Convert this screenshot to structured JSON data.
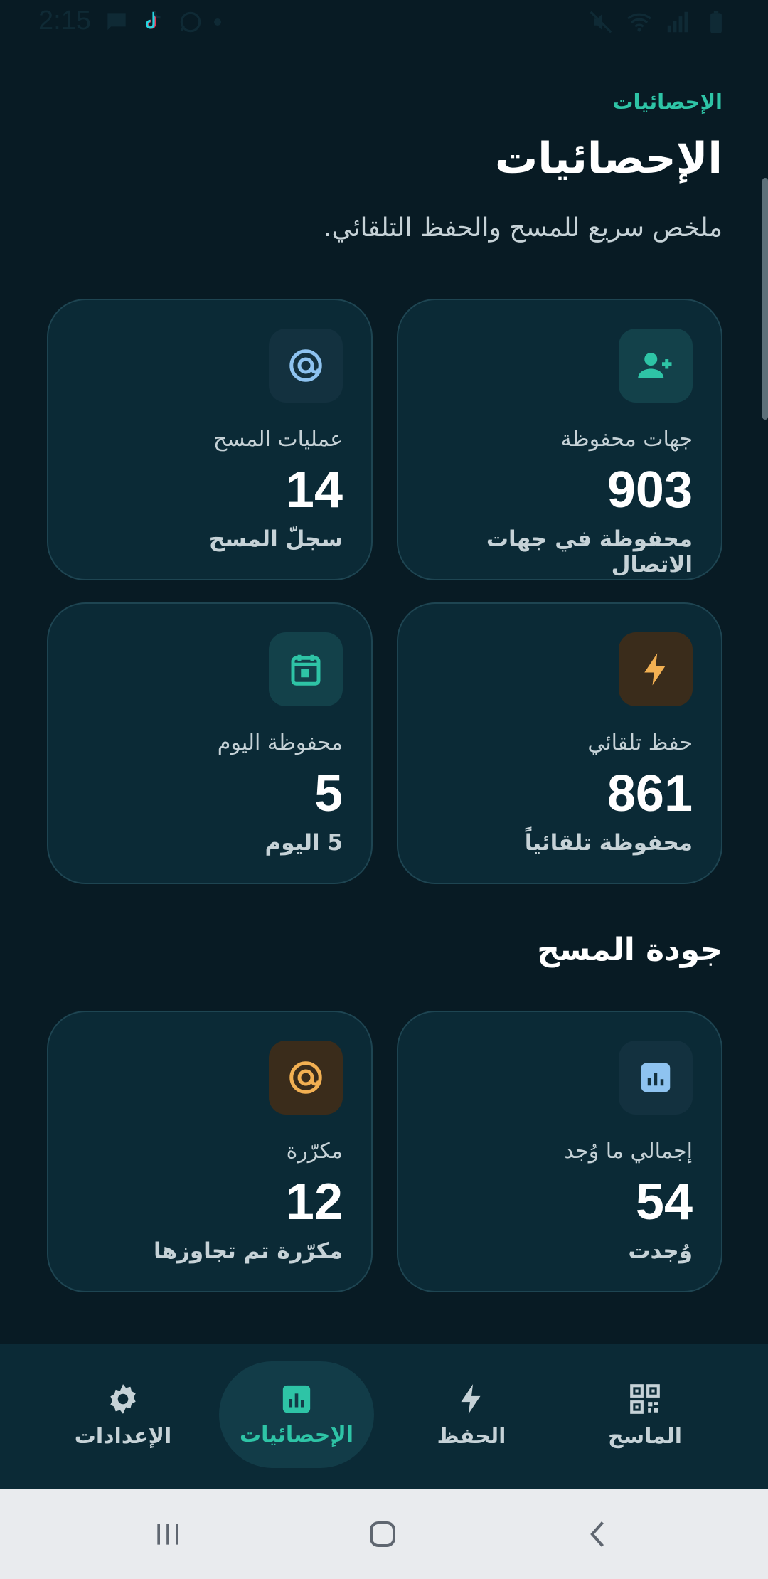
{
  "status_bar": {
    "time": "2:15",
    "left_icons": [
      "message-icon",
      "tiktok-icon",
      "whatsapp-icon",
      "dot-icon"
    ],
    "right_icons": [
      "mute-icon",
      "wifi-icon",
      "signal-icon",
      "battery-icon"
    ]
  },
  "header": {
    "eyebrow": "الإحصائيات",
    "title": "الإحصائيات",
    "subtitle": "ملخص سريع للمسح والحفظ التلقائي."
  },
  "stats": [
    {
      "icon": "person-add-icon",
      "icon_color": "#2ec4a6",
      "icon_bg": "#13414a",
      "label": "جهات محفوظة",
      "value": "903",
      "sub": "محفوظة في جهات الاتصال"
    },
    {
      "icon": "at-target-icon",
      "icon_color": "#8ec3f0",
      "icon_bg": "#13313f",
      "label": "عمليات المسح",
      "value": "14",
      "sub": "سجلّ المسح"
    },
    {
      "icon": "bolt-icon",
      "icon_color": "#f2b052",
      "icon_bg": "#3a2c1b",
      "label": "حفظ تلقائي",
      "value": "861",
      "sub": "محفوظة تلقائياً"
    },
    {
      "icon": "calendar-icon",
      "icon_color": "#2ec4a6",
      "icon_bg": "#13414a",
      "label": "محفوظة اليوم",
      "value": "5",
      "sub": "5 اليوم"
    }
  ],
  "quality": {
    "title": "جودة المسح",
    "items": [
      {
        "icon": "chart-icon",
        "icon_color": "#8ec3f0",
        "icon_bg": "#13313f",
        "label": "إجمالي ما وُجد",
        "value": "54",
        "sub": "وُجدت"
      },
      {
        "icon": "at-target-icon",
        "icon_color": "#f2b052",
        "icon_bg": "#3a2c1b",
        "label": "مكرّرة",
        "value": "12",
        "sub": "مكرّرة تم تجاوزها"
      }
    ]
  },
  "bottom_nav": {
    "items": [
      {
        "label": "الإعدادات",
        "icon": "gear-icon",
        "active": false
      },
      {
        "label": "الإحصائيات",
        "icon": "chart-icon",
        "active": true
      },
      {
        "label": "الحفظ",
        "icon": "bolt-icon",
        "active": false
      },
      {
        "label": "الماسح",
        "icon": "qr-code-icon",
        "active": false
      }
    ]
  },
  "colors": {
    "background": "#081b24",
    "card": "#0b2a36",
    "accent": "#2ec4a6",
    "nav_bg": "#0b2a36",
    "system_nav_bg": "#e9ebee"
  }
}
